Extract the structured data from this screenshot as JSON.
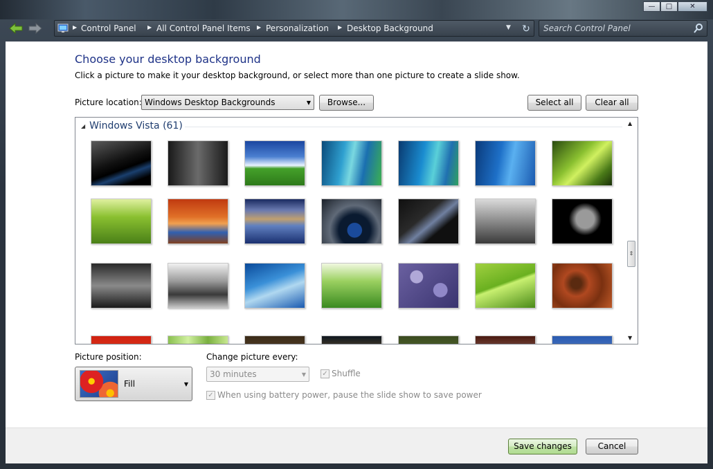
{
  "window": {
    "caption_buttons": [
      "minimize-icon",
      "maximize-icon",
      "close-icon"
    ]
  },
  "address_bar": {
    "breadcrumbs": [
      "Control Panel",
      "All Control Panel Items",
      "Personalization",
      "Desktop Background"
    ],
    "search_placeholder": "Search Control Panel"
  },
  "page": {
    "title": "Choose your desktop background",
    "subtitle": "Click a picture to make it your desktop background, or select more than one picture to create a slide show.",
    "picture_location_label": "Picture location:",
    "picture_location_value": "Windows Desktop Backgrounds",
    "browse_label": "Browse...",
    "select_all_label": "Select all",
    "clear_all_label": "Clear all"
  },
  "gallery": {
    "group_title": "Windows Vista (61)",
    "thumbnails": [
      "vista-black-swoosh",
      "vista-gray-logo",
      "green-hill-blue-sky",
      "aurora-blue-green",
      "aurora-teal",
      "aurora-blue",
      "green-fern",
      "green-grass",
      "red-rock-arch",
      "mountain-lake-reflection",
      "vista-orb-dark",
      "dark-light-streaks",
      "train-interior-bw",
      "leaves-bw",
      "city-night-bw",
      "tree-rocks-bw",
      "fish-school",
      "grass-dew",
      "purple-pebbles",
      "green-leaf",
      "wood-grain",
      "red-flower",
      "bamboo",
      "brown-partial",
      "sunset-partial",
      "flowers-partial",
      "pink-partial",
      "blue-mountains-partial"
    ]
  },
  "settings": {
    "picture_position_label": "Picture position:",
    "picture_position_value": "Fill",
    "change_every_label": "Change picture every:",
    "change_every_value": "30 minutes",
    "shuffle_label": "Shuffle",
    "battery_label": "When using battery power, pause the slide show to save power"
  },
  "footer": {
    "save_label": "Save changes",
    "cancel_label": "Cancel"
  }
}
